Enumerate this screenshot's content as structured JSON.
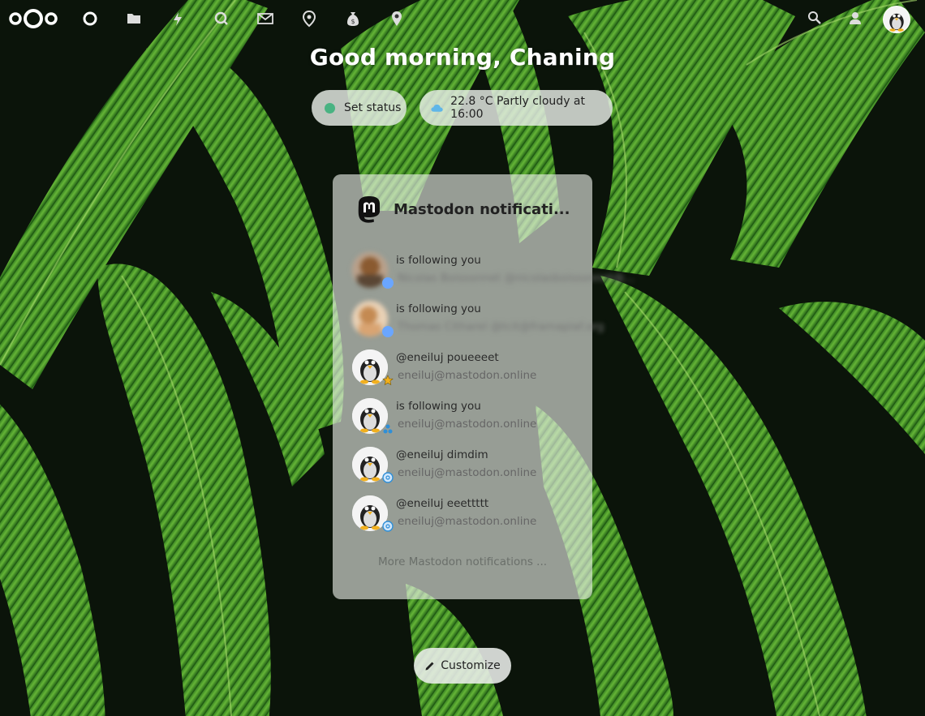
{
  "greeting": "Good morning, Chaning",
  "status_pill": {
    "label": "Set status",
    "dot_color": "#49b382"
  },
  "weather_pill": {
    "label": "22.8 °C Partly cloudy at 16:00",
    "icon": "cloud-icon"
  },
  "top_nav": {
    "left_icons": [
      "logo",
      "dashboard-icon",
      "files-icon",
      "activity-icon",
      "search-circle-icon",
      "mail-icon",
      "maps-icon",
      "money-icon",
      "location-icon"
    ],
    "right_icons": [
      "search-icon",
      "contacts-icon",
      "user-avatar"
    ]
  },
  "widget": {
    "title": "Mastodon notificati...",
    "items": [
      {
        "main": "is following you",
        "sub": "Nicolas Boissonnet @nicolasboissonnet@...",
        "avatar": "blurred",
        "badge": "follow"
      },
      {
        "main": "is following you",
        "sub": "Thomas Citharel @tcit@framapiaf.org",
        "avatar": "blurred",
        "badge": "follow"
      },
      {
        "main": "@eneiluj poueeeet",
        "sub": "eneiluj@mastodon.online",
        "avatar": "penguin",
        "badge": "favourite"
      },
      {
        "main": "is following you",
        "sub": "eneiluj@mastodon.online",
        "avatar": "penguin",
        "badge": "follow"
      },
      {
        "main": "@eneiluj dimdim",
        "sub": "eneiluj@mastodon.online",
        "avatar": "penguin",
        "badge": "mention"
      },
      {
        "main": "@eneiluj eeettttt",
        "sub": "eneiluj@mastodon.online",
        "avatar": "penguin",
        "badge": "mention"
      }
    ],
    "more": "More Mastodon notifications ..."
  },
  "customize": {
    "label": "Customize"
  },
  "colors": {
    "accent": "#49b382",
    "leaf": "#3f8f2a",
    "background": "#0b140a"
  }
}
